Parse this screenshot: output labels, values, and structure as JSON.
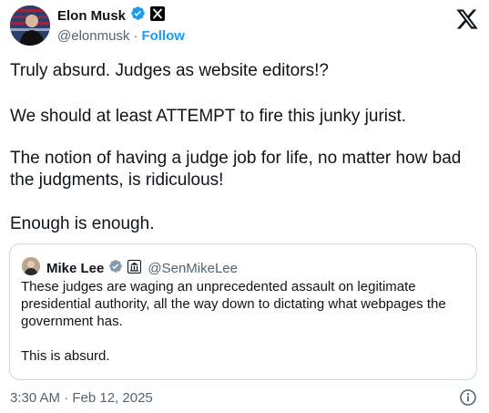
{
  "author": {
    "name": "Elon Musk",
    "handle": "@elonmusk",
    "separator": "·",
    "follow_label": "Follow"
  },
  "tweet": {
    "paragraphs": [
      "Truly absurd. Judges as website editors!?",
      "We should at least ATTEMPT to fire this junky jurist.",
      "The notion of having a judge job for life, no matter how bad the judgments, is ridiculous!",
      "Enough is enough."
    ],
    "timestamp": "3:30 AM · Feb 12, 2025"
  },
  "quote": {
    "name": "Mike Lee",
    "handle": "@SenMikeLee",
    "paragraphs": [
      "These judges are waging an unprecedented assault on legitimate presidential authority, all the way down to dictating what webpages the government has.",
      "This is absurd."
    ]
  },
  "icons": {
    "verified": "verified-badge-icon",
    "affiliate_x": "x-affiliate-icon",
    "government": "government-affiliate-icon",
    "platform": "x-logo-icon",
    "info": "info-icon"
  },
  "colors": {
    "accent": "#1d9bf0",
    "secondary_text": "#536471",
    "border": "#cfd9de"
  }
}
